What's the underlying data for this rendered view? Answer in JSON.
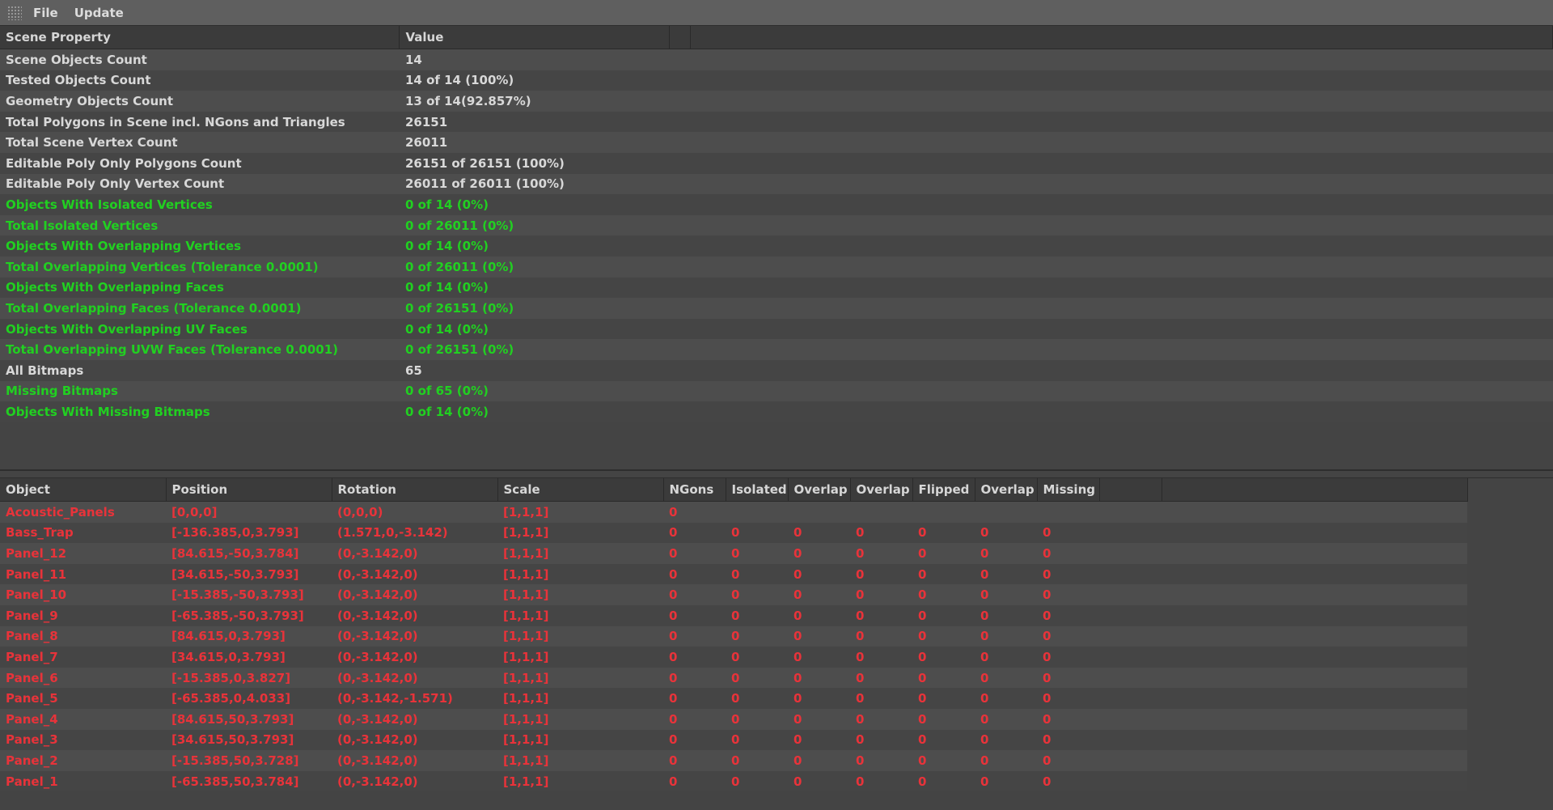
{
  "menu": {
    "file": "File",
    "update": "Update"
  },
  "colors": {
    "ok": "#21d021",
    "error": "#e8333a",
    "default": "#d8d8d8"
  },
  "properties": {
    "headers": [
      "Scene Property",
      "Value",
      "",
      ""
    ],
    "rows": [
      {
        "property": "Scene Objects Count",
        "value": "14",
        "status": "default"
      },
      {
        "property": "Tested Objects Count",
        "value": "14 of 14 (100%)",
        "status": "default"
      },
      {
        "property": "Geometry Objects Count",
        "value": "13 of 14(92.857%)",
        "status": "default"
      },
      {
        "property": "Total Polygons in Scene incl. NGons and Triangles",
        "value": "26151",
        "status": "default"
      },
      {
        "property": "Total Scene Vertex Count",
        "value": "26011",
        "status": "default"
      },
      {
        "property": "Editable Poly Only Polygons Count",
        "value": "26151 of 26151 (100%)",
        "status": "default"
      },
      {
        "property": "Editable Poly Only Vertex Count",
        "value": "26011 of 26011 (100%)",
        "status": "default"
      },
      {
        "property": "Objects With Isolated Vertices",
        "value": "0 of 14 (0%)",
        "status": "green"
      },
      {
        "property": "Total Isolated Vertices",
        "value": "0 of 26011 (0%)",
        "status": "green"
      },
      {
        "property": "Objects With Overlapping Vertices",
        "value": "0 of 14 (0%)",
        "status": "green"
      },
      {
        "property": "Total Overlapping Vertices (Tolerance 0.0001)",
        "value": "0 of 26011 (0%)",
        "status": "green"
      },
      {
        "property": "Objects With Overlapping Faces",
        "value": "0 of 14 (0%)",
        "status": "green"
      },
      {
        "property": "Total Overlapping Faces (Tolerance 0.0001)",
        "value": "0 of 26151 (0%)",
        "status": "green"
      },
      {
        "property": "Objects With Overlapping UV Faces",
        "value": "0 of 14 (0%)",
        "status": "green"
      },
      {
        "property": "Total Overlapping UVW Faces (Tolerance 0.0001)",
        "value": "0 of 26151 (0%)",
        "status": "green"
      },
      {
        "property": "All Bitmaps",
        "value": "65",
        "status": "default"
      },
      {
        "property": "Missing Bitmaps",
        "value": "0 of 65 (0%)",
        "status": "green"
      },
      {
        "property": "Objects With Missing Bitmaps",
        "value": "0 of 14 (0%)",
        "status": "green"
      }
    ]
  },
  "objects": {
    "headers": [
      "Object",
      "Position",
      "Rotation",
      "Scale",
      "NGons",
      "Isolated",
      "Overlap",
      "Overlap",
      "Flipped",
      "Overlap",
      "Missing",
      "",
      ""
    ],
    "rows": [
      {
        "name": "Acoustic_Panels",
        "position": "[0,0,0]",
        "rotation": "(0,0,0)",
        "scale": "[1,1,1]",
        "ngons": "0",
        "isolated": "",
        "overlap1": "",
        "overlap2": "",
        "flipped": "",
        "overlap3": "",
        "missing": ""
      },
      {
        "name": "Bass_Trap",
        "position": "[-136.385,0,3.793]",
        "rotation": "(1.571,0,-3.142)",
        "scale": "[1,1,1]",
        "ngons": "0",
        "isolated": "0",
        "overlap1": "0",
        "overlap2": "0",
        "flipped": "0",
        "overlap3": "0",
        "missing": "0"
      },
      {
        "name": "Panel_12",
        "position": "[84.615,-50,3.784]",
        "rotation": "(0,-3.142,0)",
        "scale": "[1,1,1]",
        "ngons": "0",
        "isolated": "0",
        "overlap1": "0",
        "overlap2": "0",
        "flipped": "0",
        "overlap3": "0",
        "missing": "0"
      },
      {
        "name": "Panel_11",
        "position": "[34.615,-50,3.793]",
        "rotation": "(0,-3.142,0)",
        "scale": "[1,1,1]",
        "ngons": "0",
        "isolated": "0",
        "overlap1": "0",
        "overlap2": "0",
        "flipped": "0",
        "overlap3": "0",
        "missing": "0"
      },
      {
        "name": "Panel_10",
        "position": "[-15.385,-50,3.793]",
        "rotation": "(0,-3.142,0)",
        "scale": "[1,1,1]",
        "ngons": "0",
        "isolated": "0",
        "overlap1": "0",
        "overlap2": "0",
        "flipped": "0",
        "overlap3": "0",
        "missing": "0"
      },
      {
        "name": "Panel_9",
        "position": "[-65.385,-50,3.793]",
        "rotation": "(0,-3.142,0)",
        "scale": "[1,1,1]",
        "ngons": "0",
        "isolated": "0",
        "overlap1": "0",
        "overlap2": "0",
        "flipped": "0",
        "overlap3": "0",
        "missing": "0"
      },
      {
        "name": "Panel_8",
        "position": "[84.615,0,3.793]",
        "rotation": "(0,-3.142,0)",
        "scale": "[1,1,1]",
        "ngons": "0",
        "isolated": "0",
        "overlap1": "0",
        "overlap2": "0",
        "flipped": "0",
        "overlap3": "0",
        "missing": "0"
      },
      {
        "name": "Panel_7",
        "position": "[34.615,0,3.793]",
        "rotation": "(0,-3.142,0)",
        "scale": "[1,1,1]",
        "ngons": "0",
        "isolated": "0",
        "overlap1": "0",
        "overlap2": "0",
        "flipped": "0",
        "overlap3": "0",
        "missing": "0"
      },
      {
        "name": "Panel_6",
        "position": "[-15.385,0,3.827]",
        "rotation": "(0,-3.142,0)",
        "scale": "[1,1,1]",
        "ngons": "0",
        "isolated": "0",
        "overlap1": "0",
        "overlap2": "0",
        "flipped": "0",
        "overlap3": "0",
        "missing": "0"
      },
      {
        "name": "Panel_5",
        "position": "[-65.385,0,4.033]",
        "rotation": "(0,-3.142,-1.571)",
        "scale": "[1,1,1]",
        "ngons": "0",
        "isolated": "0",
        "overlap1": "0",
        "overlap2": "0",
        "flipped": "0",
        "overlap3": "0",
        "missing": "0"
      },
      {
        "name": "Panel_4",
        "position": "[84.615,50,3.793]",
        "rotation": "(0,-3.142,0)",
        "scale": "[1,1,1]",
        "ngons": "0",
        "isolated": "0",
        "overlap1": "0",
        "overlap2": "0",
        "flipped": "0",
        "overlap3": "0",
        "missing": "0"
      },
      {
        "name": "Panel_3",
        "position": "[34.615,50,3.793]",
        "rotation": "(0,-3.142,0)",
        "scale": "[1,1,1]",
        "ngons": "0",
        "isolated": "0",
        "overlap1": "0",
        "overlap2": "0",
        "flipped": "0",
        "overlap3": "0",
        "missing": "0"
      },
      {
        "name": "Panel_2",
        "position": "[-15.385,50,3.728]",
        "rotation": "(0,-3.142,0)",
        "scale": "[1,1,1]",
        "ngons": "0",
        "isolated": "0",
        "overlap1": "0",
        "overlap2": "0",
        "flipped": "0",
        "overlap3": "0",
        "missing": "0"
      },
      {
        "name": "Panel_1",
        "position": "[-65.385,50,3.784]",
        "rotation": "(0,-3.142,0)",
        "scale": "[1,1,1]",
        "ngons": "0",
        "isolated": "0",
        "overlap1": "0",
        "overlap2": "0",
        "flipped": "0",
        "overlap3": "0",
        "missing": "0"
      }
    ]
  }
}
